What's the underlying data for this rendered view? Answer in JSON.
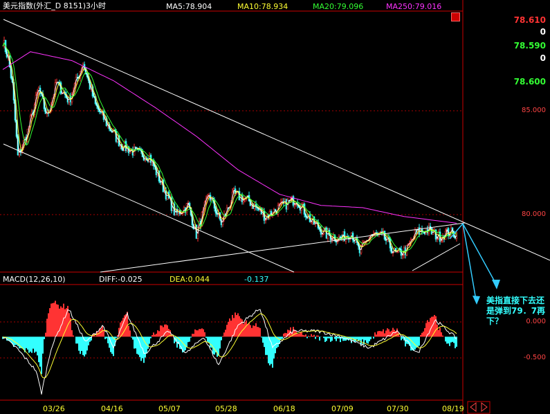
{
  "header": {
    "title": "美元指数(外汇_D 8151)3小时",
    "ma5": "MA5:78.904",
    "ma10": "MA10:78.934",
    "ma20": "MA20:79.096",
    "ma250": "MA250:79.016"
  },
  "right_panel": {
    "price1": "78.610",
    "zero1": "0",
    "price2": "78.590",
    "zero2": "0",
    "price3": "78.600"
  },
  "annotation": "美指直接下去还是弹到79．7再下？",
  "macd_header": {
    "label": "MACD(12,26,10)",
    "diff": "DIFF:-0.025",
    "dea": "DEA:0.044",
    "macd": "-0.137"
  },
  "colors": {
    "background": "#000000",
    "up_candle": "#ff3333",
    "down_candle": "#33ffff",
    "ma5": "#ffffff",
    "ma10": "#ffff33",
    "ma20": "#33ff33",
    "ma250": "#ff33ff",
    "grid": "#aa0000",
    "trendline": "#ffffff",
    "arrow": "#33ccff"
  },
  "chart_data": {
    "type": "candlestick",
    "x_ticks": [
      "03/26",
      "04/16",
      "05/07",
      "05/28",
      "06/18",
      "07/09",
      "07/30",
      "08/19"
    ],
    "y_ticks": [
      "85.000",
      "80.000"
    ],
    "ylim": [
      77.5,
      89.0
    ],
    "close_path": [
      {
        "i": 0,
        "v": 87.8
      },
      {
        "i": 8,
        "v": 87.0
      },
      {
        "i": 14,
        "v": 85.8
      },
      {
        "i": 22,
        "v": 82.6
      },
      {
        "i": 34,
        "v": 83.5
      },
      {
        "i": 52,
        "v": 85.6
      },
      {
        "i": 64,
        "v": 84.4
      },
      {
        "i": 78,
        "v": 85.9
      },
      {
        "i": 96,
        "v": 85.1
      },
      {
        "i": 116,
        "v": 86.8
      },
      {
        "i": 134,
        "v": 84.9
      },
      {
        "i": 152,
        "v": 84.0
      },
      {
        "i": 172,
        "v": 83.1
      },
      {
        "i": 190,
        "v": 82.8
      },
      {
        "i": 212,
        "v": 82.6
      },
      {
        "i": 232,
        "v": 81.2
      },
      {
        "i": 250,
        "v": 80.0
      },
      {
        "i": 268,
        "v": 80.4
      },
      {
        "i": 280,
        "v": 79.1
      },
      {
        "i": 298,
        "v": 80.9
      },
      {
        "i": 316,
        "v": 79.6
      },
      {
        "i": 334,
        "v": 80.9
      },
      {
        "i": 356,
        "v": 80.6
      },
      {
        "i": 380,
        "v": 79.9
      },
      {
        "i": 400,
        "v": 80.3
      },
      {
        "i": 424,
        "v": 80.7
      },
      {
        "i": 446,
        "v": 79.7
      },
      {
        "i": 468,
        "v": 79.1
      },
      {
        "i": 488,
        "v": 78.9
      },
      {
        "i": 504,
        "v": 79.2
      },
      {
        "i": 516,
        "v": 78.3
      },
      {
        "i": 532,
        "v": 79.1
      },
      {
        "i": 550,
        "v": 79.0
      },
      {
        "i": 568,
        "v": 78.2
      },
      {
        "i": 584,
        "v": 78.4
      },
      {
        "i": 598,
        "v": 79.2
      },
      {
        "i": 614,
        "v": 79.3
      },
      {
        "i": 630,
        "v": 79.0
      },
      {
        "i": 644,
        "v": 79.2
      },
      {
        "i": 656,
        "v": 79.1
      }
    ],
    "ma250_path": [
      {
        "i": 0,
        "v": 86.5
      },
      {
        "i": 40,
        "v": 87.3
      },
      {
        "i": 100,
        "v": 86.9
      },
      {
        "i": 160,
        "v": 86.0
      },
      {
        "i": 220,
        "v": 84.8
      },
      {
        "i": 280,
        "v": 83.5
      },
      {
        "i": 340,
        "v": 82.0
      },
      {
        "i": 400,
        "v": 80.9
      },
      {
        "i": 460,
        "v": 80.4
      },
      {
        "i": 520,
        "v": 80.3
      },
      {
        "i": 580,
        "v": 79.9
      },
      {
        "i": 656,
        "v": 79.6
      }
    ],
    "macd": {
      "ylim": [
        -1.1,
        0.9
      ],
      "y_ticks": [
        "0.000",
        "-0.500"
      ],
      "diff_path": [
        {
          "i": 0,
          "v": 0.0
        },
        {
          "i": 20,
          "v": -0.2
        },
        {
          "i": 48,
          "v": -0.6
        },
        {
          "i": 56,
          "v": -1.0
        },
        {
          "i": 70,
          "v": -0.2
        },
        {
          "i": 95,
          "v": 0.5
        },
        {
          "i": 120,
          "v": -0.1
        },
        {
          "i": 145,
          "v": 0.2
        },
        {
          "i": 160,
          "v": -0.2
        },
        {
          "i": 180,
          "v": 0.4
        },
        {
          "i": 205,
          "v": -0.3
        },
        {
          "i": 240,
          "v": 0.1
        },
        {
          "i": 265,
          "v": -0.3
        },
        {
          "i": 290,
          "v": 0.0
        },
        {
          "i": 312,
          "v": -0.5
        },
        {
          "i": 340,
          "v": 0.2
        },
        {
          "i": 372,
          "v": 0.5
        },
        {
          "i": 390,
          "v": -0.2
        },
        {
          "i": 420,
          "v": 0.1
        },
        {
          "i": 455,
          "v": 0.1
        },
        {
          "i": 490,
          "v": 0.0
        },
        {
          "i": 530,
          "v": -0.2
        },
        {
          "i": 570,
          "v": 0.1
        },
        {
          "i": 600,
          "v": -0.3
        },
        {
          "i": 625,
          "v": 0.3
        },
        {
          "i": 656,
          "v": -0.03
        }
      ]
    }
  }
}
